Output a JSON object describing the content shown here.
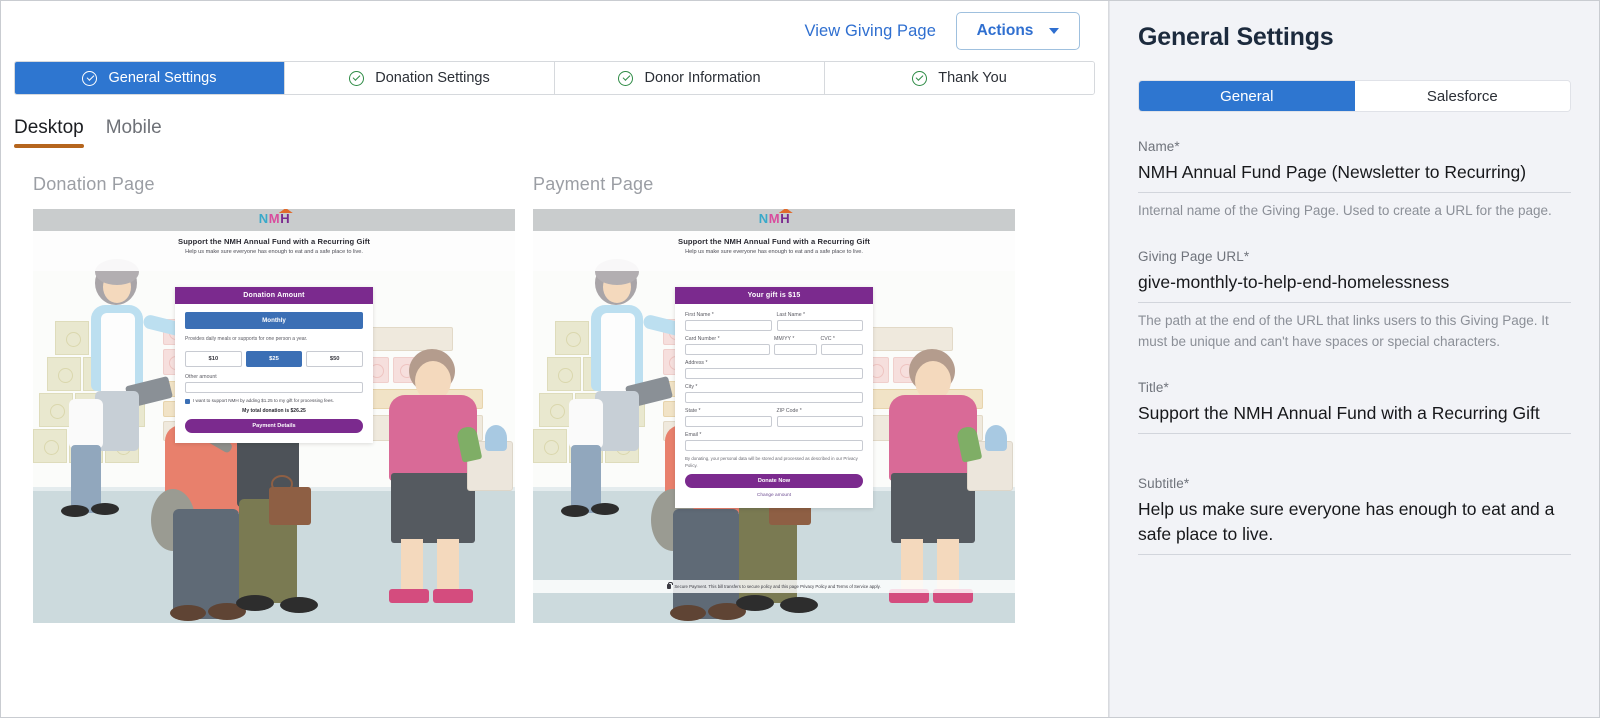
{
  "topbar": {
    "view_link": "View Giving Page",
    "actions_label": "Actions"
  },
  "steps": [
    {
      "label": "General Settings",
      "active": true
    },
    {
      "label": "Donation Settings",
      "active": false
    },
    {
      "label": "Donor Information",
      "active": false
    },
    {
      "label": "Thank You",
      "active": false
    }
  ],
  "device_tabs": [
    {
      "label": "Desktop",
      "active": true
    },
    {
      "label": "Mobile",
      "active": false
    }
  ],
  "previews": {
    "donation": {
      "title": "Donation Page",
      "hero_title": "Support the NMH Annual Fund with a Recurring Gift",
      "hero_subtitle": "Help us make sure everyone has enough to eat and a safe place to live.",
      "card_header": "Donation Amount",
      "frequency_button": "Monthly",
      "note": "Provides daily meals or supports for one person a year.",
      "amounts": [
        "$10",
        "$25",
        "$50"
      ],
      "selected_amount": "$25",
      "other_label": "Other amount",
      "fee_checkbox": "I want to support NMH by adding $1.25 to my gift for processing fees.",
      "total": "My total donation is $26.25",
      "submit": "Payment Details"
    },
    "payment": {
      "title": "Payment Page",
      "hero_title": "Support the NMH Annual Fund with a Recurring Gift",
      "hero_subtitle": "Help us make sure everyone has enough to eat and a safe place to live.",
      "card_header": "Your gift is $15",
      "fields": {
        "first_name": "First Name *",
        "last_name": "Last Name *",
        "card_number": "Card Number *",
        "exp": "MM/YY *",
        "cvc": "CVC *",
        "address": "Address *",
        "city": "City *",
        "state": "State *",
        "zip": "ZIP Code *",
        "email": "Email *"
      },
      "legal": "By donating, your personal data will be stored and processed as described in our Privacy Policy.",
      "submit": "Donate Now",
      "change_amount": "Change amount",
      "secure_note": "Secure Payment. This bill transfers to secure policy and this page Privacy Policy and Terms of Service apply."
    },
    "logo": {
      "n": "N",
      "m": "M",
      "h": "H"
    }
  },
  "panel": {
    "title": "General Settings",
    "tabs": [
      {
        "label": "General",
        "active": true
      },
      {
        "label": "Salesforce",
        "active": false
      }
    ],
    "fields": [
      {
        "label": "Name",
        "required": "*",
        "value": "NMH Annual Fund Page (Newsletter to Recurring)",
        "help": "Internal name of the Giving Page. Used to create a URL for the page."
      },
      {
        "label": "Giving Page URL",
        "required": "*",
        "value": "give-monthly-to-help-end-homelessness",
        "help": "The path at the end of the URL that links users to this Giving Page. It must be unique and can't have spaces or special characters."
      },
      {
        "label": "Title",
        "required": "*",
        "value": "Support the NMH Annual Fund with a Recurring Gift",
        "help": ""
      },
      {
        "label": "Subtitle",
        "required": "*",
        "value": "Help us make sure everyone has enough to eat and a safe place to live.",
        "help": ""
      }
    ]
  },
  "colors": {
    "accent_blue": "#2e76d0",
    "link_blue": "#2f6fd0",
    "brand_purple": "#7b2a8e",
    "tab_underline": "#b5651d",
    "check_green": "#2e8b45"
  }
}
